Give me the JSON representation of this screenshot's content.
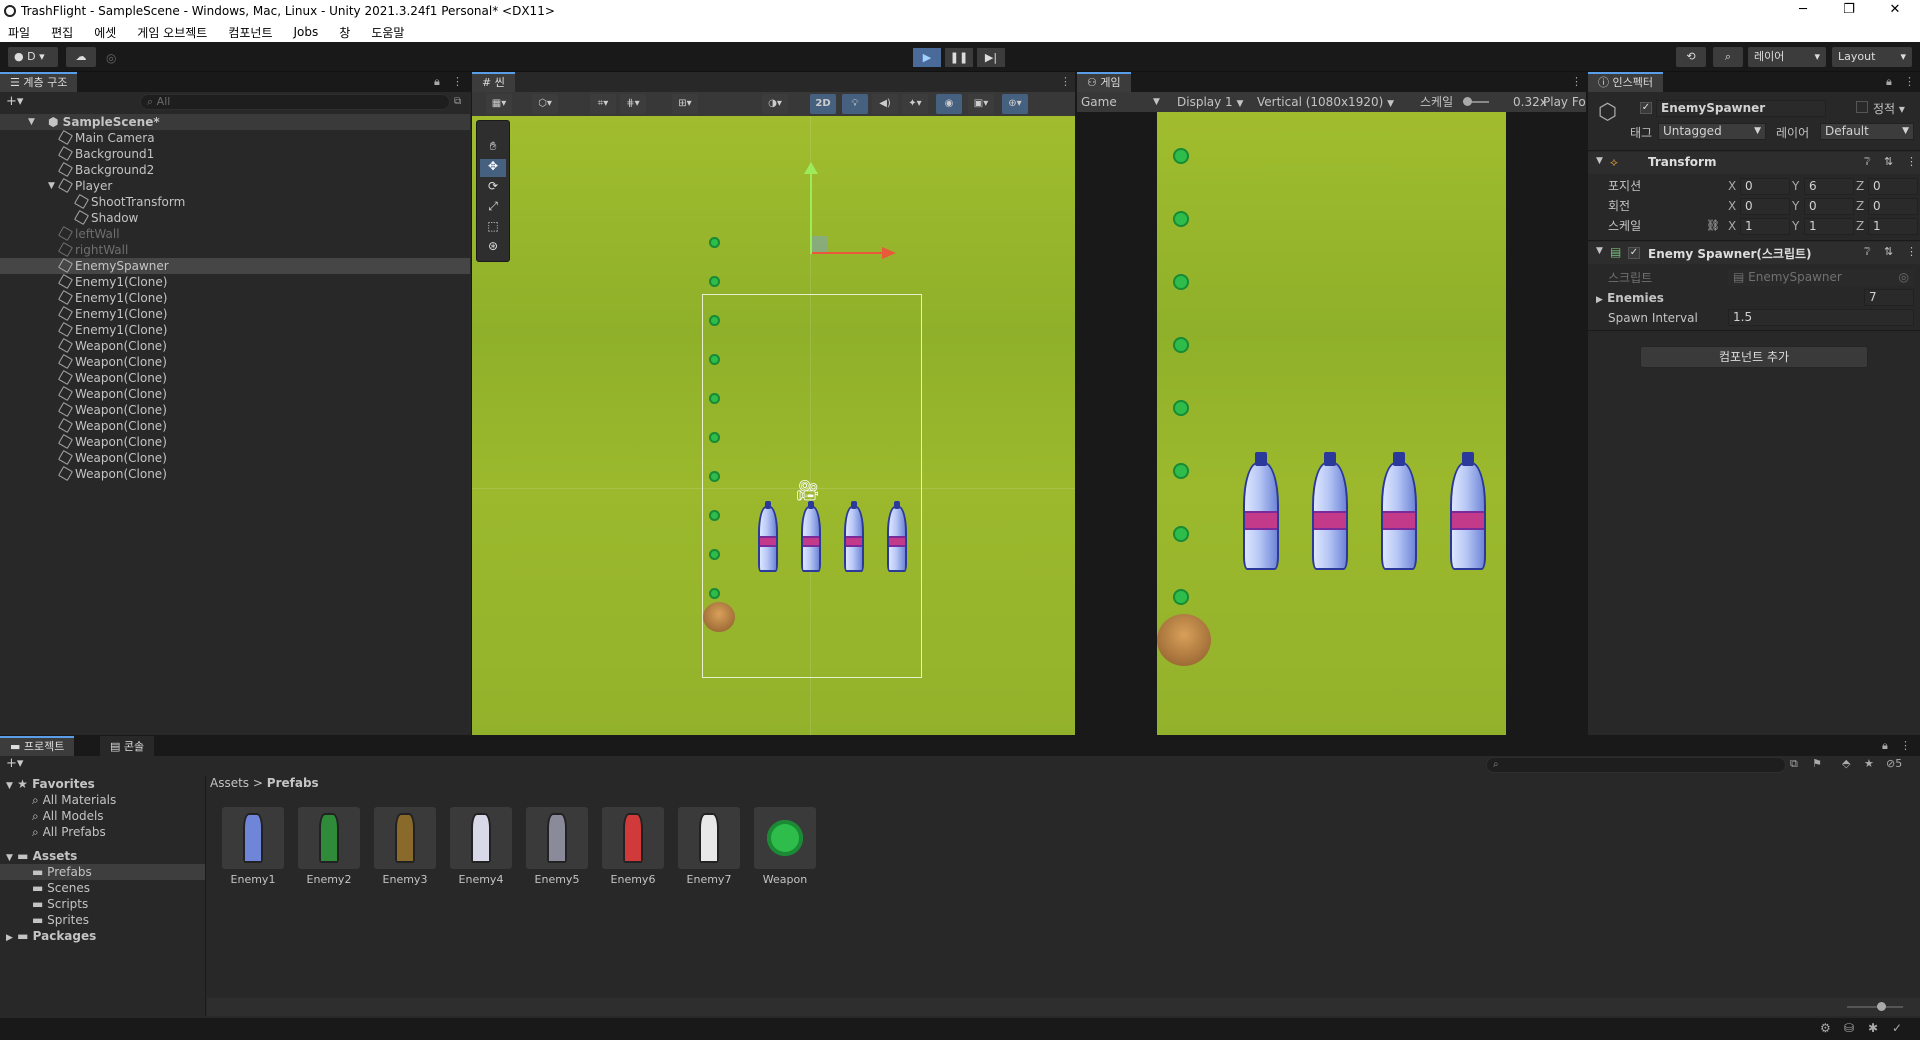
{
  "window": {
    "title": "TrashFlight - SampleScene - Windows, Mac, Linux - Unity 2021.3.24f1 Personal* <DX11>",
    "minimize": "─",
    "maximize": "❐",
    "close": "✕"
  },
  "menu": [
    "파일",
    "편집",
    "에셋",
    "게임 오브젝트",
    "컴포넌트",
    "Jobs",
    "창",
    "도움말"
  ],
  "toolbar": {
    "account": "D",
    "layers": "레이어",
    "layout": "Layout"
  },
  "hierarchy": {
    "tab": "계층 구조",
    "search_placeholder": "All",
    "scene": "SampleScene*",
    "items": [
      {
        "label": "Main Camera",
        "depth": 1,
        "dim": false
      },
      {
        "label": "Background1",
        "depth": 1,
        "dim": false
      },
      {
        "label": "Background2",
        "depth": 1,
        "dim": false
      },
      {
        "label": "Player",
        "depth": 1,
        "dim": false
      },
      {
        "label": "ShootTransform",
        "depth": 2,
        "dim": false
      },
      {
        "label": "Shadow",
        "depth": 2,
        "dim": false
      },
      {
        "label": "leftWall",
        "depth": 1,
        "dim": true
      },
      {
        "label": "rightWall",
        "depth": 1,
        "dim": true
      },
      {
        "label": "EnemySpawner",
        "depth": 1,
        "dim": false
      },
      {
        "label": "Enemy1(Clone)",
        "depth": 1,
        "dim": false
      },
      {
        "label": "Enemy1(Clone)",
        "depth": 1,
        "dim": false
      },
      {
        "label": "Enemy1(Clone)",
        "depth": 1,
        "dim": false
      },
      {
        "label": "Enemy1(Clone)",
        "depth": 1,
        "dim": false
      },
      {
        "label": "Weapon(Clone)",
        "depth": 1,
        "dim": false
      },
      {
        "label": "Weapon(Clone)",
        "depth": 1,
        "dim": false
      },
      {
        "label": "Weapon(Clone)",
        "depth": 1,
        "dim": false
      },
      {
        "label": "Weapon(Clone)",
        "depth": 1,
        "dim": false
      },
      {
        "label": "Weapon(Clone)",
        "depth": 1,
        "dim": false
      },
      {
        "label": "Weapon(Clone)",
        "depth": 1,
        "dim": false
      },
      {
        "label": "Weapon(Clone)",
        "depth": 1,
        "dim": false
      },
      {
        "label": "Weapon(Clone)",
        "depth": 1,
        "dim": false
      },
      {
        "label": "Weapon(Clone)",
        "depth": 1,
        "dim": false
      }
    ]
  },
  "scene": {
    "tab": "씬",
    "mode_2d": "2D"
  },
  "game": {
    "tab": "게임",
    "game_dropdown": "Game",
    "display": "Display 1",
    "resolution": "Vertical (1080x1920)",
    "scale_label": "스케일",
    "scale_value": "0.32x",
    "play_focused": "Play Fo"
  },
  "inspector": {
    "tab": "인스펙터",
    "object_name": "EnemySpawner",
    "static_label": "정적",
    "tag_label": "태그",
    "tag_value": "Untagged",
    "layer_label": "레이어",
    "layer_value": "Default",
    "transform": {
      "title": "Transform",
      "position_label": "포지션",
      "rotation_label": "회전",
      "scale_label": "스케일",
      "position": {
        "x": "0",
        "y": "6",
        "z": "0"
      },
      "rotation": {
        "x": "0",
        "y": "0",
        "z": "0"
      },
      "scale": {
        "x": "1",
        "y": "1",
        "z": "1"
      }
    },
    "script_component": {
      "title": "Enemy Spawner(스크립트)",
      "script_label": "스크립트",
      "script_value": "EnemySpawner",
      "enemies_label": "Enemies",
      "enemies_count": "7",
      "spawn_interval_label": "Spawn Interval",
      "spawn_interval_value": "1.5"
    },
    "add_component": "컴포넌트 추가"
  },
  "project": {
    "tab_project": "프로젝트",
    "tab_console": "콘솔",
    "favorites_label": "Favorites",
    "favorites": [
      "All Materials",
      "All Models",
      "All Prefabs"
    ],
    "assets_label": "Assets",
    "folders": [
      "Prefabs",
      "Scenes",
      "Scripts",
      "Sprites"
    ],
    "packages_label": "Packages",
    "breadcrumb_root": "Assets",
    "breadcrumb_sep": ">",
    "breadcrumb_current": "Prefabs",
    "hidden_count": "5",
    "prefabs": [
      {
        "name": "Enemy1",
        "color": "#6f86d8"
      },
      {
        "name": "Enemy2",
        "color": "#2f8a3a"
      },
      {
        "name": "Enemy3",
        "color": "#8a6a2a"
      },
      {
        "name": "Enemy4",
        "color": "#d8d8e8"
      },
      {
        "name": "Enemy5",
        "color": "#8a8a9a"
      },
      {
        "name": "Enemy6",
        "color": "#d03a3a"
      },
      {
        "name": "Enemy7",
        "color": "#e8e8e8"
      },
      {
        "name": "Weapon",
        "color": "#2ebd4a"
      }
    ]
  }
}
